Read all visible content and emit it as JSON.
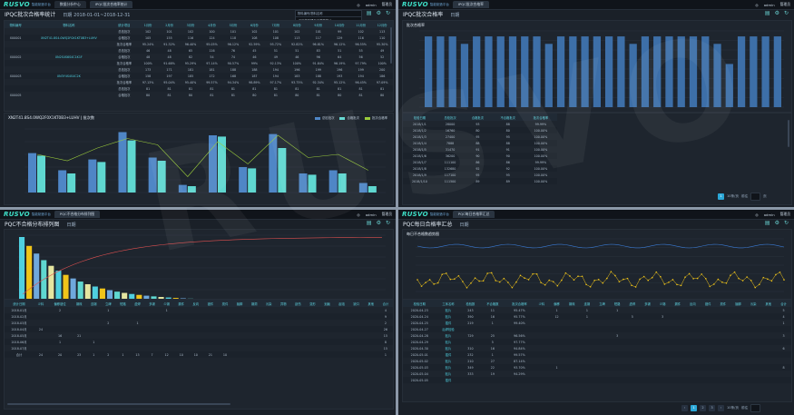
{
  "q1": {
    "logo": "RUSVO",
    "logo_sub": "智能制造平台",
    "tabs": [
      "数据分析中心",
      "IPQC批次合格率统计"
    ],
    "user": "admin",
    "logout": "管理员",
    "title": "IPQC批次合格率统计",
    "range_label": "日期",
    "range": "2018-01-01~2018-12-31",
    "search_placeholder": "物料编号/物料名称",
    "dropdown": [
      "工序检验项目合格率统计",
      "物料批次合格率",
      "检验员合格率统计"
    ],
    "table_headers": [
      "物料编号",
      "物料名称",
      "统计项目",
      "1月份",
      "2月份",
      "3月份",
      "4月份",
      "5月份",
      "6月份",
      "7月份",
      "8月份",
      "9月份",
      "10月份",
      "11月份",
      "12月份"
    ],
    "rows": [
      [
        "",
        "",
        "总检批次",
        "102",
        "101",
        "102",
        "100",
        "101",
        "102",
        "101",
        "102",
        "101",
        "99",
        "102",
        "113"
      ],
      [
        "X00001",
        "XN2T41.8S4.0WQ2F0X1KT0B3+LUHV",
        "合格批次",
        "105",
        "155",
        "116",
        "124",
        "118",
        "108",
        "108",
        "113",
        "117",
        "129",
        "116",
        "110"
      ],
      [
        "",
        "",
        "批次合格率",
        "95.24%",
        "91.32%",
        "96.40%",
        "95.05%",
        "96.12%",
        "92.59%",
        "95.72%",
        "92.82%",
        "96.81%",
        "96.12%",
        "96.55%",
        "95.30%"
      ],
      [
        "",
        "",
        "总检批次",
        "46",
        "48",
        "65",
        "116",
        "76",
        "45",
        "51",
        "51",
        "83",
        "51",
        "55",
        "49"
      ],
      [
        "X00002",
        "XN2S4S6S4C1K1F",
        "合格批次",
        "48",
        "48",
        "82",
        "54",
        "74",
        "46",
        "49",
        "46",
        "96",
        "64",
        "56",
        "52"
      ],
      [
        "",
        "",
        "批次合格率",
        "100%",
        "91.68%",
        "95.29%",
        "97.14%",
        "90.57%",
        "99%",
        "92.13%",
        "100%",
        "91.84%",
        "96.19%",
        "97.79%",
        "100%"
      ],
      [
        "",
        "",
        "总检批次",
        "173",
        "171",
        "181",
        "181",
        "188",
        "188",
        "194",
        "196",
        "199",
        "196",
        "199",
        "200"
      ],
      [
        "X00003",
        "XN3Y4S4S4C2K",
        "合格批次",
        "158",
        "197",
        "185",
        "172",
        "168",
        "187",
        "194",
        "183",
        "188",
        "193",
        "194",
        "186"
      ],
      [
        "",
        "",
        "批次合格率",
        "97.13%",
        "95.04%",
        "95.40%",
        "99.57%",
        "94.34%",
        "98.89%",
        "97.17%",
        "93.75%",
        "92.34%",
        "95.12%",
        "96.45%",
        "97.09%"
      ],
      [
        "",
        "",
        "总检批次",
        "81",
        "81",
        "81",
        "81",
        "81",
        "81",
        "81",
        "81",
        "81",
        "81",
        "81",
        "81"
      ],
      [
        "X00005",
        "",
        "合格批次",
        "80",
        "81",
        "80",
        "81",
        "81",
        "80",
        "81",
        "80",
        "81",
        "80",
        "81",
        "80"
      ]
    ],
    "chart": {
      "title": "XN2T41.8S4.0WQ2F0X1KT0B3+LUHV | 批次数",
      "legend": [
        "总检批次",
        "合格批次",
        "批次合格率"
      ],
      "colors": [
        "#4f86c6",
        "#5fd7d0",
        "#9acb3b"
      ]
    }
  },
  "q2": {
    "logo": "RUSVO",
    "logo_sub": "智能制造平台",
    "tabs": [
      "IPQC批次合格率"
    ],
    "user": "admin",
    "logout": "管理员",
    "title": "IPQC批次合格率",
    "range_label": "日期",
    "chart_title": "批次合格率",
    "table_headers": [
      "检验日期",
      "总检批次",
      "合格批次",
      "不合格批次",
      "批次合格率"
    ],
    "rows": [
      [
        "2018/1/1",
        "28000",
        "93",
        "88",
        "99.99%"
      ],
      [
        "2018/1/2",
        "16760",
        "80",
        "80",
        "100.00%"
      ],
      [
        "2018/1/3",
        "27400",
        "95",
        "95",
        "100.00%"
      ],
      [
        "2018/1/4",
        "7888",
        "88",
        "88",
        "100.00%"
      ],
      [
        "2018/1/5",
        "31470",
        "91",
        "91",
        "100.00%"
      ],
      [
        "2018/1/6",
        "36200",
        "90",
        "90",
        "100.00%"
      ],
      [
        "2018/1/7",
        "111100",
        "86",
        "86",
        "99.99%"
      ],
      [
        "2018/1/8",
        "132680",
        "92",
        "92",
        "100.00%"
      ],
      [
        "2018/1/9",
        "117100",
        "95",
        "95",
        "100.00%"
      ],
      [
        "2018/1/10",
        "111500",
        "89",
        "89",
        "100.00%"
      ]
    ],
    "pager": {
      "page": "1",
      "size": "10条/页",
      "goto": "前往",
      "unit": "页"
    }
  },
  "q3": {
    "logo": "RUSVO",
    "logo_sub": "智能制造平台",
    "tabs": [
      "PQC不合格分布排列图"
    ],
    "user": "admin",
    "logout": "管理员",
    "title": "PQC不合格分布排列图",
    "range_label": "日期",
    "table_headers": [
      "统计日期",
      "少料",
      "偏移错位",
      "锡珠",
      "连锡",
      "立碑",
      "短路",
      "虚焊",
      "多锡",
      "少锡",
      "漏件",
      "反向",
      "错件",
      "损件",
      "翘脚",
      "锡洞",
      "污染",
      "异物",
      "刮伤",
      "变形",
      "划痕",
      "起泡",
      "缺口",
      "其他",
      "合计"
    ],
    "rows": [
      [
        "2018-01月",
        "",
        "2",
        "",
        "",
        "1",
        "",
        "",
        "",
        "1",
        "",
        "",
        "",
        "",
        "",
        "",
        "",
        "",
        "",
        "",
        "",
        "",
        "",
        "",
        "4"
      ],
      [
        "2018-02月",
        "",
        "",
        "",
        "",
        "",
        "",
        "",
        "",
        "",
        "",
        "",
        "",
        "",
        "",
        "",
        "",
        "",
        "",
        "",
        "",
        "",
        "",
        "",
        "9"
      ],
      [
        "2018-03月",
        "",
        "",
        "",
        "",
        "2",
        "",
        "1",
        "",
        "",
        "",
        "",
        "",
        "",
        "",
        "",
        "",
        "",
        "",
        "",
        "",
        "",
        "",
        "",
        "2"
      ],
      [
        "2018-04月",
        "24",
        "",
        "",
        "",
        "",
        "",
        "",
        "",
        "",
        "",
        "",
        "",
        "",
        "",
        "",
        "",
        "",
        "",
        "",
        "",
        "",
        "",
        "",
        "26"
      ],
      [
        "2018-05月",
        "",
        "16",
        "21",
        "",
        "",
        "",
        "",
        "",
        "",
        "",
        "",
        "",
        "",
        "",
        "",
        "",
        "",
        "",
        "",
        "",
        "",
        "",
        "",
        "15"
      ],
      [
        "2018-06月",
        "",
        "1",
        "",
        "1",
        "",
        "",
        "",
        "",
        "",
        "",
        "",
        "",
        "",
        "",
        "",
        "",
        "",
        "",
        "",
        "",
        "",
        "",
        "",
        "8"
      ],
      [
        "2018-07月",
        "",
        "",
        "",
        "",
        "",
        "",
        "",
        "",
        "",
        "",
        "",
        "",
        "",
        "",
        "",
        "",
        "",
        "",
        "",
        "",
        "",
        "",
        "",
        "15"
      ],
      [
        "合计",
        "24",
        "20",
        "23",
        "1",
        "2",
        "1",
        "13",
        "7",
        "12",
        "10",
        "10",
        "21",
        "10",
        "",
        "",
        "",
        "",
        "",
        "",
        "",
        "",
        "",
        "",
        "1"
      ]
    ]
  },
  "q4": {
    "logo": "RUSVO",
    "logo_sub": "智能制造平台",
    "tabs": [
      "PQC每日合格率汇总"
    ],
    "user": "admin",
    "logout": "管理员",
    "title": "PQC每日合格率汇总",
    "range_label": "日期",
    "chart_title": "每日不合格数趋势图",
    "table_headers": [
      "检验日期",
      "工序名称",
      "检验数",
      "不合格数",
      "批次合格率",
      "少料",
      "偏移",
      "锡珠",
      "连锡",
      "立碑",
      "短路",
      "虚焊",
      "多锡",
      "少锡",
      "漏件",
      "反向",
      "错件",
      "损件",
      "翘脚",
      "污染",
      "其他",
      "合计"
    ],
    "rows": [
      [
        "2020-04-23",
        "贴片",
        "243",
        "11",
        "95.47%",
        "",
        "1",
        "",
        "1",
        "",
        "1",
        "",
        "",
        "",
        "",
        "",
        "",
        "",
        "",
        "",
        "",
        "5"
      ],
      [
        "2020-04-24",
        "贴片",
        "390",
        "16",
        "95.77%",
        "",
        "12",
        "",
        "1",
        "",
        "",
        "5",
        "",
        "3",
        "",
        "",
        "",
        "",
        "",
        "",
        "",
        "4"
      ],
      [
        "2020-04-25",
        "插件",
        "219",
        "1",
        "99.40%",
        "",
        "",
        "",
        "",
        "",
        "",
        "",
        "",
        "",
        "",
        "",
        "",
        "",
        "",
        "",
        "",
        "1"
      ],
      [
        "2020-04-27",
        "后焊检验",
        "",
        "",
        "",
        "",
        "",
        "",
        "",
        "",
        "",
        "",
        "",
        "",
        "",
        "",
        "",
        "",
        "",
        "",
        "",
        ""
      ],
      [
        "2020-04-28",
        "贴片",
        "729",
        "25",
        "96.56%",
        "",
        "",
        "",
        "",
        "",
        "3",
        "",
        "",
        "",
        "",
        "",
        "",
        "",
        "",
        "",
        "",
        "3"
      ],
      [
        "2020-04-29",
        "贴片",
        "",
        "5",
        "97.77%",
        "",
        "",
        "",
        "",
        "",
        "",
        "",
        "",
        "",
        "",
        "",
        "",
        "",
        "",
        "",
        "",
        ""
      ],
      [
        "2020-04-30",
        "贴片",
        "310",
        "16",
        "94.84%",
        "",
        "",
        "",
        "",
        "",
        "",
        "",
        "",
        "",
        "",
        "",
        "",
        "",
        "",
        "",
        "",
        "6"
      ],
      [
        "2020-05-01",
        "插件",
        "232",
        "1",
        "99.57%",
        "",
        "",
        "",
        "",
        "",
        "",
        "",
        "",
        "",
        "",
        "",
        "",
        "",
        "",
        "",
        "",
        ""
      ],
      [
        "2020-05-02",
        "贴片",
        "210",
        "27",
        "87.14%",
        "",
        "",
        "",
        "",
        "",
        "",
        "",
        "",
        "",
        "",
        "",
        "",
        "",
        "",
        "",
        "",
        ""
      ],
      [
        "2020-05-03",
        "贴片",
        "349",
        "22",
        "93.70%",
        "",
        "1",
        "",
        "",
        "",
        "",
        "",
        "",
        "",
        "",
        "",
        "",
        "",
        "",
        "",
        "",
        "8"
      ],
      [
        "2020-05-04",
        "贴片",
        "333",
        "19",
        "94.29%",
        "",
        "",
        "",
        "",
        "",
        "",
        "",
        "",
        "",
        "",
        "",
        "",
        "",
        "",
        "",
        "",
        ""
      ],
      [
        "2020-05-05",
        "插件",
        "",
        "",
        "",
        "",
        "",
        "",
        "",
        "",
        "",
        "",
        "",
        "",
        "",
        "",
        "",
        "",
        "",
        "",
        "",
        ""
      ]
    ],
    "pager": {
      "page": "1",
      "size": "10条/页",
      "goto": "前往",
      "unit": "页"
    }
  }
}
